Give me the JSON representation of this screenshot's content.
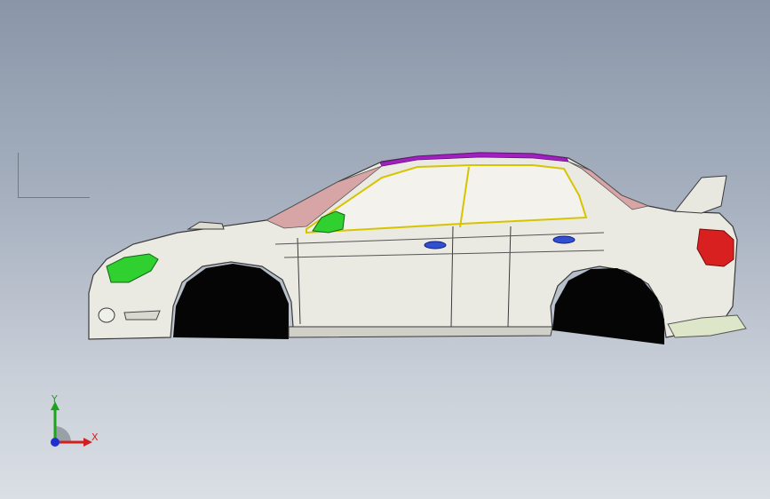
{
  "viewport": {
    "model": "car-body",
    "background": "#9aa5b5"
  },
  "triad": {
    "y_label": "Y",
    "x_label": "X",
    "y_color": "#1aa51a",
    "x_color": "#d02020",
    "z_color": "#2030d0"
  }
}
